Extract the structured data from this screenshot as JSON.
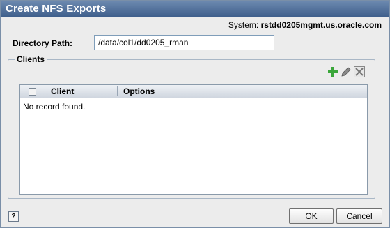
{
  "dialog": {
    "title": "Create NFS Exports",
    "system_label": "System:",
    "system_value": "rstdd0205mgmt.us.oracle.com"
  },
  "form": {
    "directory_label": "Directory Path:",
    "directory_value": "/data/col1/dd0205_rman"
  },
  "clients": {
    "legend": "Clients",
    "toolbar": {
      "add_icon": "add-icon",
      "edit_icon": "edit-pencil-icon",
      "delete_icon": "delete-x-icon"
    },
    "columns": [
      "Client",
      "Options"
    ],
    "empty_message": "No record found."
  },
  "footer": {
    "help_label": "?",
    "ok_label": "OK",
    "cancel_label": "Cancel"
  },
  "colors": {
    "titlebar": "#4f6f99",
    "add_icon": "#3aa63a",
    "panel": "#ececec"
  }
}
